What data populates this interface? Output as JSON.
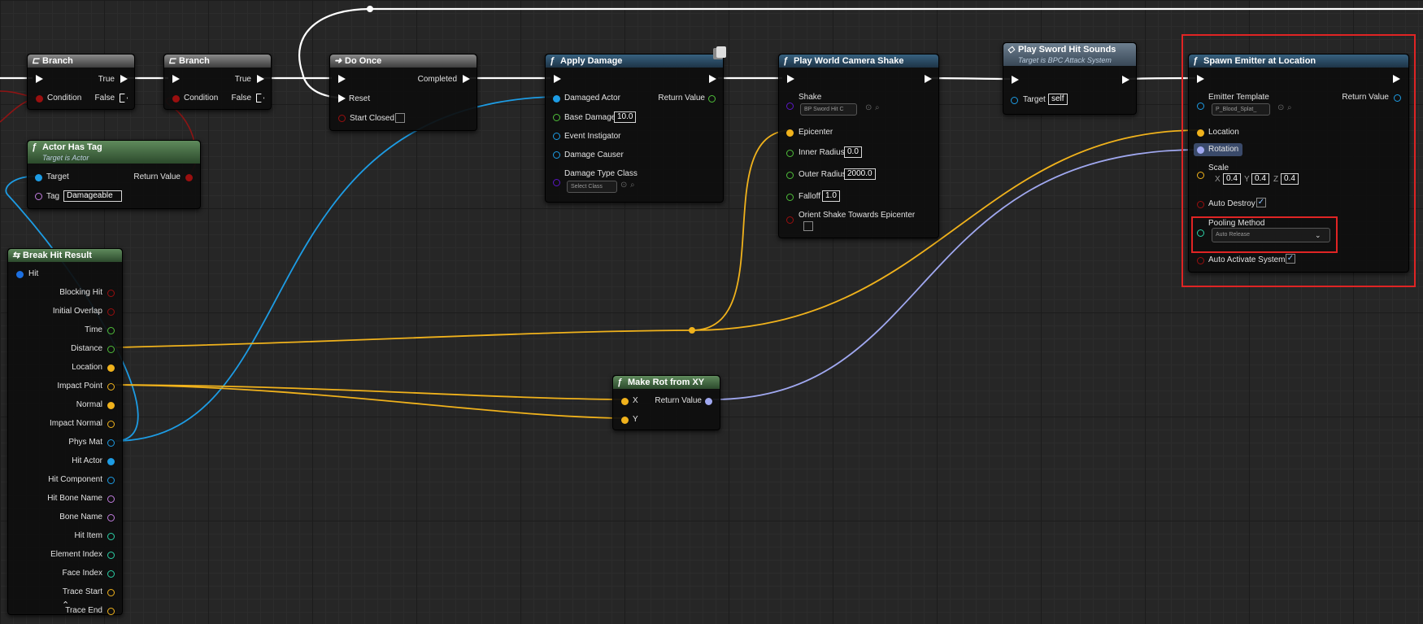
{
  "nodes": {
    "branch1": {
      "title": "Branch",
      "true_label": "True",
      "condition_label": "Condition",
      "false_label": "False"
    },
    "branch2": {
      "title": "Branch",
      "true_label": "True",
      "condition_label": "Condition",
      "false_label": "False"
    },
    "do_once": {
      "title": "Do Once",
      "completed_label": "Completed",
      "reset_label": "Reset",
      "start_closed_label": "Start Closed"
    },
    "actor_has_tag": {
      "title": "Actor Has Tag",
      "subtitle": "Target is Actor",
      "target_label": "Target",
      "return_label": "Return Value",
      "tag_label": "Tag",
      "tag_value": "Damageable"
    },
    "apply_damage": {
      "title": "Apply Damage",
      "damaged_actor_label": "Damaged Actor",
      "return_label": "Return Value",
      "base_damage_label": "Base Damage",
      "base_damage_value": "10.0",
      "event_instigator_label": "Event Instigator",
      "damage_causer_label": "Damage Causer",
      "damage_type_label": "Damage Type Class",
      "damage_type_value": "Select Class"
    },
    "camera_shake": {
      "title": "Play World Camera Shake",
      "shake_label": "Shake",
      "shake_value": "BP Sword Hit C",
      "epicenter_label": "Epicenter",
      "inner_radius_label": "Inner Radius",
      "inner_radius_value": "0.0",
      "outer_radius_label": "Outer Radius",
      "outer_radius_value": "2000.0",
      "falloff_label": "Falloff",
      "falloff_value": "1.0",
      "orient_label": "Orient Shake Towards Epicenter"
    },
    "sword_sounds": {
      "title": "Play Sword Hit Sounds",
      "subtitle": "Target is BPC Attack System",
      "target_label": "Target",
      "target_value": "self"
    },
    "spawn_emitter": {
      "title": "Spawn Emitter at Location",
      "template_label": "Emitter Template",
      "template_value": "P_Blood_Splat_",
      "return_label": "Return Value",
      "location_label": "Location",
      "rotation_label": "Rotation",
      "scale_label": "Scale",
      "scale_x_label": "X",
      "scale_x": "0.4",
      "scale_y_label": "Y",
      "scale_y": "0.4",
      "scale_z_label": "Z",
      "scale_z": "0.4",
      "auto_destroy_label": "Auto Destroy",
      "pooling_label": "Pooling Method",
      "pooling_value": "Auto Release",
      "auto_activate_label": "Auto Activate System"
    },
    "break_hit": {
      "title": "Break Hit Result",
      "hit_label": "Hit",
      "pins": [
        "Blocking Hit",
        "Initial Overlap",
        "Time",
        "Distance",
        "Location",
        "Impact Point",
        "Normal",
        "Impact Normal",
        "Phys Mat",
        "Hit Actor",
        "Hit Component",
        "Hit Bone Name",
        "Bone Name",
        "Hit Item",
        "Element Index",
        "Face Index",
        "Trace Start",
        "Trace End"
      ],
      "collapse_glyph": "⌃"
    },
    "make_rot": {
      "title": "Make Rot from XY",
      "x_label": "X",
      "y_label": "Y",
      "return_label": "Return Value"
    }
  },
  "icons": {
    "branch": "branch-icon",
    "function": "function-icon",
    "do_once": "do-once-icon",
    "event": "event-diamond-icon",
    "function_glyph": "ƒ"
  },
  "colors": {
    "exec": "#ffffff",
    "bool": "#9a0f0f",
    "float": "#4fbf3a",
    "object": "#1d9ce4",
    "vector": "#f0b21c",
    "rotator": "#a0a8f0",
    "struct": "#1c6fe0",
    "name": "#c27de0",
    "int": "#2bd0a6",
    "class": "#5a17c4",
    "selection": "#e02424"
  }
}
